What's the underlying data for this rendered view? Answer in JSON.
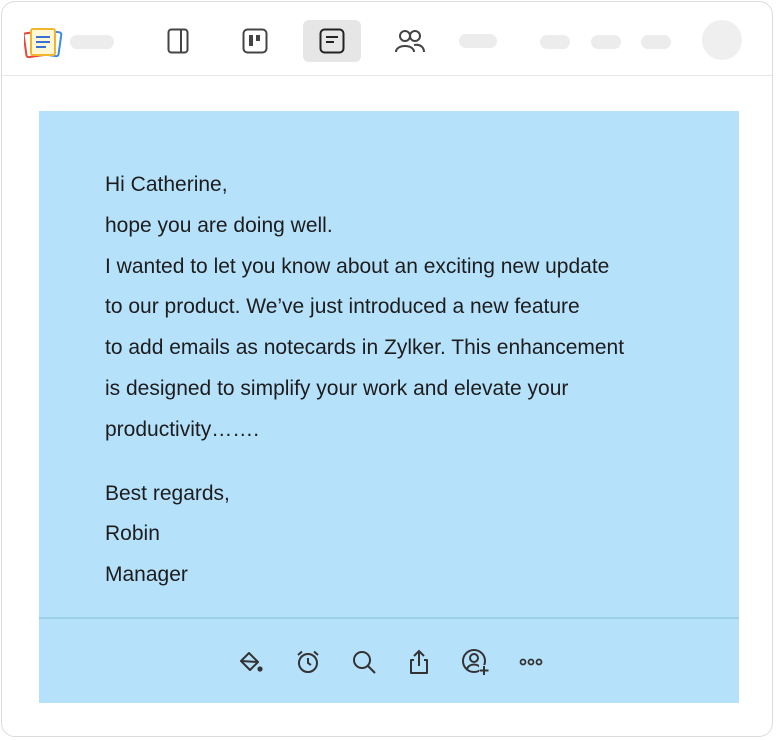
{
  "header": {
    "icons": [
      "notes-app-logo-icon",
      "notebook-icon",
      "board-view-icon",
      "notecard-view-icon",
      "people-icon"
    ],
    "active_view": "notecard-view"
  },
  "note": {
    "greeting": "Hi Catherine,",
    "lines": [
      "hope you are doing well.",
      "I wanted to let you know about an exciting new update",
      "to our product. We’ve just introduced a new feature",
      "to add emails as notecards in Zylker. This enhancement",
      "is designed to simplify your work and elevate your",
      "productivity……."
    ],
    "closing": "Best regards,",
    "signature_name": "Robin",
    "signature_title": "Manager",
    "background_color": "#b5e1fb"
  },
  "toolbar": {
    "icons": [
      "paint-bucket-icon",
      "alarm-icon",
      "search-icon",
      "share-icon",
      "add-user-icon",
      "more-icon"
    ]
  }
}
